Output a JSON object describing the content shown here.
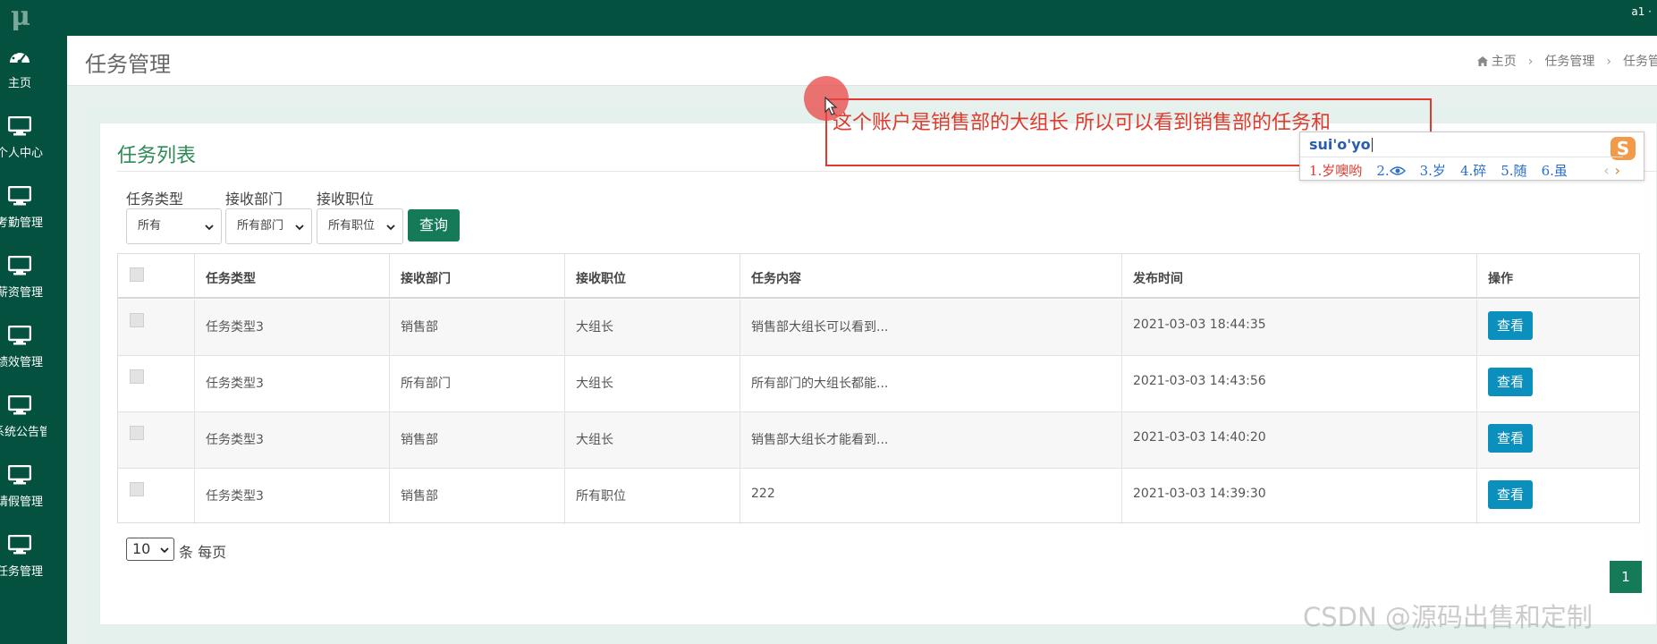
{
  "app": {
    "logo_text": "μ",
    "user": "a1 ·"
  },
  "sidebar": {
    "items": [
      {
        "label": "主页",
        "icon": "dashboard-icon"
      },
      {
        "label": "个人中心",
        "icon": "monitor-icon"
      },
      {
        "label": "考勤管理",
        "icon": "monitor-icon"
      },
      {
        "label": "薪资管理",
        "icon": "monitor-icon"
      },
      {
        "label": "绩效管理",
        "icon": "monitor-icon"
      },
      {
        "label": "系统公告管理",
        "icon": "monitor-icon"
      },
      {
        "label": "请假管理",
        "icon": "monitor-icon"
      },
      {
        "label": "任务管理",
        "icon": "monitor-icon"
      }
    ]
  },
  "header": {
    "title": "任务管理",
    "breadcrumb": [
      "主页",
      "任务管理",
      "任务管"
    ]
  },
  "panel": {
    "title": "任务列表",
    "filters": {
      "type_label": "任务类型",
      "type_value": "所有",
      "dept_label": "接收部门",
      "dept_value": "所有部门",
      "pos_label": "接收职位",
      "pos_value": "所有职位",
      "query_button": "查询"
    }
  },
  "table": {
    "columns": [
      "任务类型",
      "接收部门",
      "接收职位",
      "任务内容",
      "发布时间",
      "操作"
    ],
    "rows": [
      {
        "type": "任务类型3",
        "dept": "销售部",
        "pos": "大组长",
        "content": "销售部大组长可以看到...",
        "time": "2021-03-03 18:44:35",
        "action": "查看"
      },
      {
        "type": "任务类型3",
        "dept": "所有部门",
        "pos": "大组长",
        "content": "所有部门的大组长都能...",
        "time": "2021-03-03 14:43:56",
        "action": "查看"
      },
      {
        "type": "任务类型3",
        "dept": "销售部",
        "pos": "大组长",
        "content": "销售部大组长才能看到...",
        "time": "2021-03-03 14:40:20",
        "action": "查看"
      },
      {
        "type": "任务类型3",
        "dept": "销售部",
        "pos": "所有职位",
        "content": "222",
        "time": "2021-03-03 14:39:30",
        "action": "查看"
      }
    ]
  },
  "pagination": {
    "page_size": "10",
    "page_size_label": "条 每页",
    "current_page": "1"
  },
  "annotation": {
    "text": "这个账户是销售部的大组长 所以可以看到销售部的任务和"
  },
  "ime": {
    "input": "sui'o'yo",
    "candidates": [
      "1.岁噢哟",
      "2.",
      "3.岁",
      "4.碎",
      "5.随",
      "6.虽"
    ],
    "prev": "‹",
    "next": "›"
  },
  "watermark": "CSDN @源码出售和定制",
  "colors": {
    "sidebar": "#03513e",
    "accent": "#157a58",
    "info_button": "#0b8fbd",
    "annotation": "#e03a2e"
  }
}
